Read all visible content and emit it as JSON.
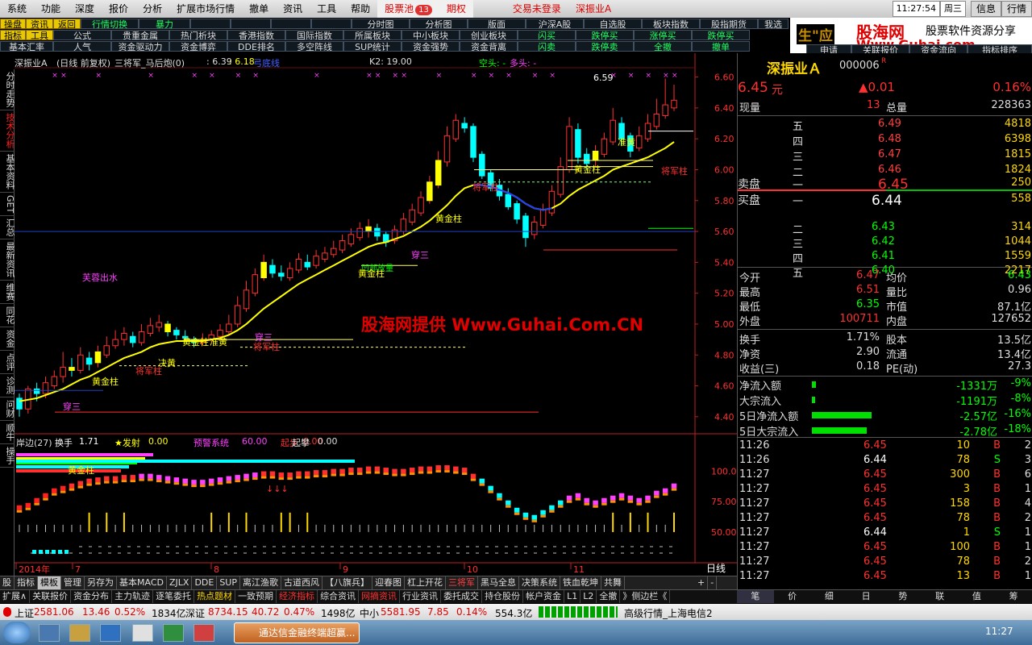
{
  "menubar": {
    "items": [
      "系统",
      "功能",
      "深度",
      "报价",
      "分析",
      "扩展市场行情",
      "撤单",
      "资讯",
      "工具",
      "帮助"
    ],
    "stock_pool": "股票池",
    "stock_pool_badge": "13",
    "warrant": "期权",
    "login_status": "交易未登录",
    "stock_name": "深振业A",
    "time": "11:27:54",
    "weekday": "周三",
    "info": "信息",
    "quote": "行情"
  },
  "toolbar1": [
    "操盘",
    "资讯",
    "返回",
    "行情切换",
    "暴力",
    "",
    "",
    "",
    "",
    "分时图",
    "分析图",
    "版面",
    "沪深A股",
    "自选股",
    "板块指数",
    "股指期货",
    "我选"
  ],
  "toolbar2": [
    "指标",
    "工具",
    "公式",
    "贵重金属",
    "热门析块",
    "香港指数",
    "国际指数",
    "所属板块",
    "中小板块",
    "创业板块",
    "闪买",
    "跌停买",
    "涨停买",
    "跌停买"
  ],
  "toolbar3": [
    "基本汇率",
    "人气",
    "资金驱动力",
    "资金博弈",
    "DDE排名",
    "多空阵线",
    "SUP统计",
    "资金强势",
    "资金背离",
    "闪卖",
    "跌停卖",
    "全撤",
    "撤单"
  ],
  "logo": {
    "name": "股海网",
    "slogan": "股票软件资源分享",
    "url": "Www.Guhai.com",
    "side": "生\"应"
  },
  "chart_header": {
    "name": "深振业A",
    "mode": "(日线 前复权)",
    "indicator": "三将军_马后炮(0)",
    "v1": ": 6.39",
    "v2": ": 6.18",
    "hint": "弓底线",
    "k2": "K2: 19.00",
    "kong": "空头: -",
    "duo": "多头: -"
  },
  "left_tabs": [
    "分时走势",
    "技术分析",
    "基本资料",
    "GET",
    "汇总",
    "最新资讯",
    "维赛",
    "同花",
    "资金",
    "点评",
    "诊测",
    "问财",
    "顺牛",
    "操手"
  ],
  "chart_annotations": {
    "watermark": "股海网提供 Www.Guhai.Com.CN",
    "fu_rong": "芙蓉出水",
    "huang_jin_zhu": "黄金柱",
    "jiang_jun_zhu": "将军柱",
    "chuan_san": "穿三",
    "zhun_huang": "准黄",
    "jue_huang": "决黄",
    "fang_liang": "凹部放量",
    "price_label": "6.59",
    "arrows": "↓↓↓"
  },
  "chart_data": {
    "type": "candlestick",
    "title": "深振业A (日线 前复权)",
    "x_ticks": [
      "2014年",
      "7",
      "8",
      "9",
      "10",
      "11"
    ],
    "y_ticks": [
      "6.60",
      "6.40",
      "6.20",
      "6.00",
      "5.80",
      "5.60",
      "5.40",
      "5.20",
      "5.00",
      "4.80",
      "4.60",
      "4.40"
    ],
    "y_range": [
      4.3,
      6.65
    ],
    "open": [
      4.52,
      4.45,
      4.58,
      4.55,
      4.6,
      4.66,
      4.72,
      4.7,
      4.78,
      4.75,
      4.8,
      4.86,
      4.9,
      4.92,
      4.88,
      4.94,
      4.98,
      5.0,
      4.96,
      4.92,
      4.9,
      4.88,
      4.9,
      4.92,
      4.95,
      5.0,
      5.1,
      5.2,
      5.3,
      5.38,
      5.33,
      5.3,
      5.35,
      5.4,
      5.38,
      5.42,
      5.45,
      5.48,
      5.52,
      5.56,
      5.6,
      5.62,
      5.58,
      5.54,
      5.6,
      5.66,
      5.72,
      5.8,
      5.9,
      6.05,
      6.2,
      6.3,
      6.28,
      6.1,
      5.98,
      5.9,
      5.84,
      5.78,
      5.7,
      5.58,
      5.64,
      5.72,
      5.84,
      6.0,
      6.26,
      6.1,
      6.06,
      6.1,
      6.18,
      6.3,
      6.22,
      6.14,
      6.2,
      6.28,
      6.35,
      6.4
    ],
    "close": [
      4.45,
      4.58,
      4.55,
      4.62,
      4.66,
      4.72,
      4.7,
      4.8,
      4.74,
      4.82,
      4.86,
      4.9,
      4.94,
      4.88,
      4.95,
      4.99,
      5.01,
      4.95,
      4.93,
      4.91,
      4.88,
      4.9,
      4.93,
      4.96,
      5.0,
      5.12,
      5.22,
      5.32,
      5.4,
      5.33,
      5.31,
      5.36,
      5.42,
      5.37,
      5.44,
      5.46,
      5.49,
      5.54,
      5.58,
      5.62,
      5.63,
      5.57,
      5.53,
      5.61,
      5.68,
      5.74,
      5.82,
      5.92,
      6.06,
      6.22,
      6.32,
      6.27,
      6.08,
      5.96,
      5.88,
      5.83,
      5.76,
      5.68,
      5.56,
      5.66,
      5.74,
      5.86,
      6.02,
      6.28,
      6.08,
      6.04,
      6.12,
      6.2,
      6.32,
      6.2,
      6.12,
      6.22,
      6.3,
      6.36,
      6.42,
      6.45
    ],
    "high": [
      4.55,
      4.6,
      4.62,
      4.66,
      4.7,
      4.82,
      4.78,
      4.85,
      4.82,
      4.86,
      4.92,
      4.96,
      4.98,
      4.95,
      5.0,
      5.04,
      5.06,
      5.02,
      4.98,
      4.96,
      4.92,
      4.94,
      4.96,
      5.0,
      5.06,
      5.18,
      5.28,
      5.36,
      5.45,
      5.42,
      5.38,
      5.4,
      5.46,
      5.45,
      5.48,
      5.5,
      5.54,
      5.58,
      5.62,
      5.66,
      5.68,
      5.65,
      5.6,
      5.64,
      5.72,
      5.78,
      5.86,
      5.96,
      6.12,
      6.28,
      6.36,
      6.34,
      6.3,
      6.12,
      6.0,
      5.94,
      5.88,
      5.8,
      5.72,
      5.7,
      5.78,
      5.9,
      6.08,
      6.34,
      6.3,
      6.14,
      6.16,
      6.24,
      6.4,
      6.34,
      6.24,
      6.28,
      6.36,
      6.46,
      6.59,
      6.55
    ],
    "low": [
      4.4,
      4.42,
      4.5,
      4.52,
      4.58,
      4.62,
      4.66,
      4.68,
      4.7,
      4.72,
      4.78,
      4.84,
      4.86,
      4.85,
      4.86,
      4.92,
      4.95,
      4.92,
      4.9,
      4.88,
      4.85,
      4.86,
      4.88,
      4.9,
      4.93,
      4.98,
      5.08,
      5.18,
      5.28,
      5.3,
      5.28,
      5.28,
      5.33,
      5.35,
      5.36,
      5.4,
      5.43,
      5.46,
      5.5,
      5.54,
      5.56,
      5.54,
      5.5,
      5.52,
      5.58,
      5.64,
      5.7,
      5.78,
      5.88,
      6.02,
      6.18,
      6.24,
      6.05,
      5.94,
      5.86,
      5.8,
      5.74,
      5.65,
      5.5,
      5.55,
      5.62,
      5.7,
      5.82,
      5.98,
      6.04,
      6.0,
      6.02,
      6.08,
      6.16,
      6.16,
      6.08,
      6.12,
      6.18,
      6.26,
      6.33,
      6.38
    ],
    "ma": [
      4.5,
      4.51,
      4.52,
      4.54,
      4.56,
      4.58,
      4.61,
      4.64,
      4.66,
      4.69,
      4.72,
      4.75,
      4.78,
      4.8,
      4.82,
      4.85,
      4.87,
      4.88,
      4.89,
      4.89,
      4.89,
      4.89,
      4.9,
      4.91,
      4.93,
      4.96,
      5.0,
      5.05,
      5.1,
      5.14,
      5.18,
      5.22,
      5.26,
      5.29,
      5.32,
      5.35,
      5.38,
      5.41,
      5.44,
      5.47,
      5.5,
      5.52,
      5.53,
      5.55,
      5.57,
      5.6,
      5.63,
      5.67,
      5.72,
      5.77,
      5.83,
      5.88,
      5.9,
      5.9,
      5.89,
      5.87,
      5.85,
      5.82,
      5.78,
      5.75,
      5.74,
      5.75,
      5.78,
      5.83,
      5.87,
      5.9,
      5.93,
      5.96,
      6.0,
      6.02,
      6.04,
      6.06,
      6.08,
      6.11,
      6.14,
      6.18
    ],
    "sub_indicator": {
      "name": "岸边(27)",
      "turnover_label": "换手",
      "turnover": "1.71",
      "fire_label": "★发射",
      "fire": "0.00",
      "warn_label": "预警系统",
      "warn": "60.00",
      "start_label": "起步",
      "start": "0.00",
      "rise_label": "起攀",
      "rise": "0.00",
      "y_ticks": [
        "100.0",
        "75.00",
        "50.00"
      ]
    }
  },
  "quote": {
    "name": "深振业Ａ",
    "code": "000006",
    "price": "6.45",
    "unit": "元",
    "change": "▲0.01",
    "change_pct": "0.16%",
    "now_label": "现量",
    "now_vol": "13",
    "total_label": "总量",
    "total_vol": "228363",
    "sell_label": "卖盘",
    "buy_label": "买盘",
    "sells": [
      {
        "level": "五",
        "price": "6.49",
        "vol": "4818"
      },
      {
        "level": "四",
        "price": "6.48",
        "vol": "6398"
      },
      {
        "level": "三",
        "price": "6.47",
        "vol": "1815"
      },
      {
        "level": "二",
        "price": "6.46",
        "vol": "1824"
      },
      {
        "level": "一",
        "price": "6.45",
        "vol": "250"
      }
    ],
    "buys": [
      {
        "level": "一",
        "price": "6.44",
        "vol": "558"
      },
      {
        "level": "二",
        "price": "6.43",
        "vol": "314"
      },
      {
        "level": "三",
        "price": "6.42",
        "vol": "1044"
      },
      {
        "level": "四",
        "price": "6.41",
        "vol": "1559"
      },
      {
        "level": "五",
        "price": "6.40",
        "vol": "2217"
      }
    ],
    "stats": [
      [
        "今开",
        "6.47",
        "均价",
        "6.43"
      ],
      [
        "最高",
        "6.51",
        "量比",
        "0.96"
      ],
      [
        "最低",
        "6.35",
        "市值",
        "87.1亿"
      ],
      [
        "外盘",
        "100711",
        "内盘",
        "127652"
      ]
    ],
    "stats2": [
      [
        "换手",
        "1.71%",
        "股本",
        "13.5亿"
      ],
      [
        "净资",
        "2.90",
        "流通",
        "13.4亿"
      ],
      [
        "收益(三)",
        "0.18",
        "PE(动)",
        "27.3"
      ]
    ],
    "flows": [
      {
        "label": "净流入额",
        "value": "-1331万",
        "pct": "-9%",
        "bar": 0.05
      },
      {
        "label": "大宗流入",
        "value": "-1191万",
        "pct": "-8%",
        "bar": 0.04
      },
      {
        "label": "5日净流入额",
        "value": "-2.57亿",
        "pct": "-16%",
        "bar": 0.74
      },
      {
        "label": "5日大宗流入",
        "value": "-2.78亿",
        "pct": "-18%",
        "bar": 0.68
      }
    ],
    "ticks": [
      [
        "11:26",
        "6.45",
        "10",
        "B",
        "2"
      ],
      [
        "11:26",
        "6.44",
        "78",
        "S",
        "3"
      ],
      [
        "11:27",
        "6.45",
        "300",
        "B",
        "6"
      ],
      [
        "11:27",
        "6.45",
        "3",
        "B",
        "1"
      ],
      [
        "11:27",
        "6.45",
        "158",
        "B",
        "4"
      ],
      [
        "11:27",
        "6.45",
        "78",
        "B",
        "2"
      ],
      [
        "11:27",
        "6.44",
        "1",
        "S",
        "1"
      ],
      [
        "11:27",
        "6.45",
        "100",
        "B",
        "1"
      ],
      [
        "11:27",
        "6.45",
        "78",
        "B",
        "2"
      ],
      [
        "11:27",
        "6.45",
        "13",
        "B",
        "1"
      ]
    ]
  },
  "top_right_links": [
    "申请",
    "关联报价",
    "资金流向",
    "指标排序"
  ],
  "bottom_tabs": [
    "股",
    "指标",
    "模板",
    "管理",
    "另存为",
    "基本MACD",
    "ZJLX",
    "DDE",
    "SUP",
    "离江渔歌",
    "古道西风",
    "【八旗兵】",
    "迎春图",
    "杠上开花",
    "三将军",
    "黑马全息",
    "决策系统",
    "铁血乾坤",
    "共舞"
  ],
  "bottom_right": [
    "+",
    "-",
    "日线"
  ],
  "link_tabs": [
    "扩展∧",
    "关联报价",
    "资金分布",
    "主力轨迹",
    "逐笔委托",
    "热点题材",
    "一致预期",
    "经济指标",
    "综合资讯",
    "网摘资讯",
    "行业资讯",
    "委托成交",
    "持仓股份",
    "帐户资金",
    "L1",
    "L2",
    "全撤",
    "》侧边栏《"
  ],
  "rp_tabs": [
    "笔",
    "价",
    "细",
    "日",
    "势",
    "联",
    "值",
    "筹"
  ],
  "status": {
    "sh_label": "上证",
    "sh": "2581.06",
    "sh_chg": "13.46",
    "sh_pct": "0.52%",
    "sh_amt": "1834亿",
    "sz_label": "深证",
    "sz": "8734.15",
    "sz_chg": "40.72",
    "sz_pct": "0.47%",
    "sz_amt": "1498亿",
    "zx_label": "中小",
    "zx": "5581.95",
    "zx_chg": "7.85",
    "zx_pct": "0.14%",
    "zx_amt": "554.3亿",
    "server": "高级行情_上海电信2"
  },
  "taskbar": {
    "app": "通达信金融终端超赢...",
    "time": "11:27"
  },
  "colors": {
    "up": "#ff3030",
    "down": "#00ffff",
    "yellow": "#ffff00",
    "green": "#00ff00",
    "bg": "#000000"
  }
}
